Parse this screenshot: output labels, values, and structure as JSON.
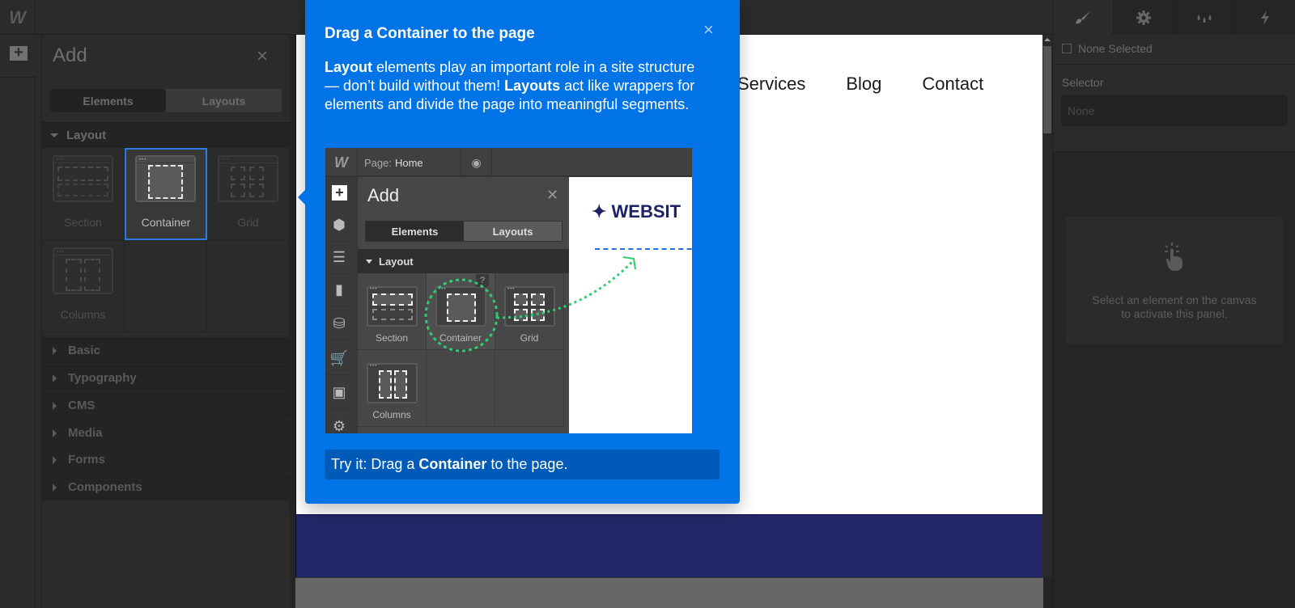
{
  "app": {
    "logo_text": "W"
  },
  "left_rail": {
    "add_icon": "plus-icon"
  },
  "add_panel": {
    "title": "Add",
    "close_icon": "×",
    "tabs": [
      {
        "label": "Elements",
        "active": true
      },
      {
        "label": "Layouts",
        "active": false
      }
    ],
    "layout_section": {
      "label": "Layout",
      "expanded": true,
      "items": [
        {
          "label": "Section",
          "selected": false
        },
        {
          "label": "Container",
          "selected": true
        },
        {
          "label": "Grid",
          "selected": false
        },
        {
          "label": "Columns",
          "selected": false
        }
      ]
    },
    "categories": [
      {
        "label": "Basic"
      },
      {
        "label": "Typography"
      },
      {
        "label": "CMS"
      },
      {
        "label": "Media"
      },
      {
        "label": "Forms"
      },
      {
        "label": "Components"
      }
    ]
  },
  "canvas": {
    "nav_links": [
      "Services",
      "Blog",
      "Contact"
    ],
    "colors": {
      "hero_band": "#222768"
    }
  },
  "right_panel": {
    "tabs": [
      {
        "icon": "brush-icon",
        "glyph": "🖌",
        "active": true
      },
      {
        "icon": "gear-icon",
        "glyph": "⚙",
        "active": false
      },
      {
        "icon": "drops-icon",
        "glyph": "💧",
        "active": false
      },
      {
        "icon": "lightning-icon",
        "glyph": "⚡",
        "active": false
      }
    ],
    "none_selected_label": "None Selected",
    "selector_label": "Selector",
    "selector_placeholder": "None",
    "empty_state_line1": "Select an element on the canvas",
    "empty_state_line2": "to activate this panel."
  },
  "tooltip": {
    "title": "Drag a Container to the page",
    "close_icon": "×",
    "body": {
      "part1_bold": "Layout",
      "part2": " elements play an important role in a site structure — don’t build without them! ",
      "part3_bold": "Layouts",
      "part4": " act like wrappers for elements and divide the page into meaningful segments."
    },
    "try_it": {
      "prefix": "Try it: Drag a ",
      "bold": "Container",
      "suffix": " to the page."
    },
    "accent_color": "#0073e6",
    "illustration": {
      "logo_text": "W",
      "page_label": "Page:",
      "page_name": "Home",
      "add_title": "Add",
      "tabs": [
        "Elements",
        "Layouts"
      ],
      "section_label": "Layout",
      "items": [
        "Section",
        "Container",
        "Grid",
        "Columns"
      ],
      "help_badge": "?",
      "site_brand": "✦ WEBSIT"
    }
  }
}
